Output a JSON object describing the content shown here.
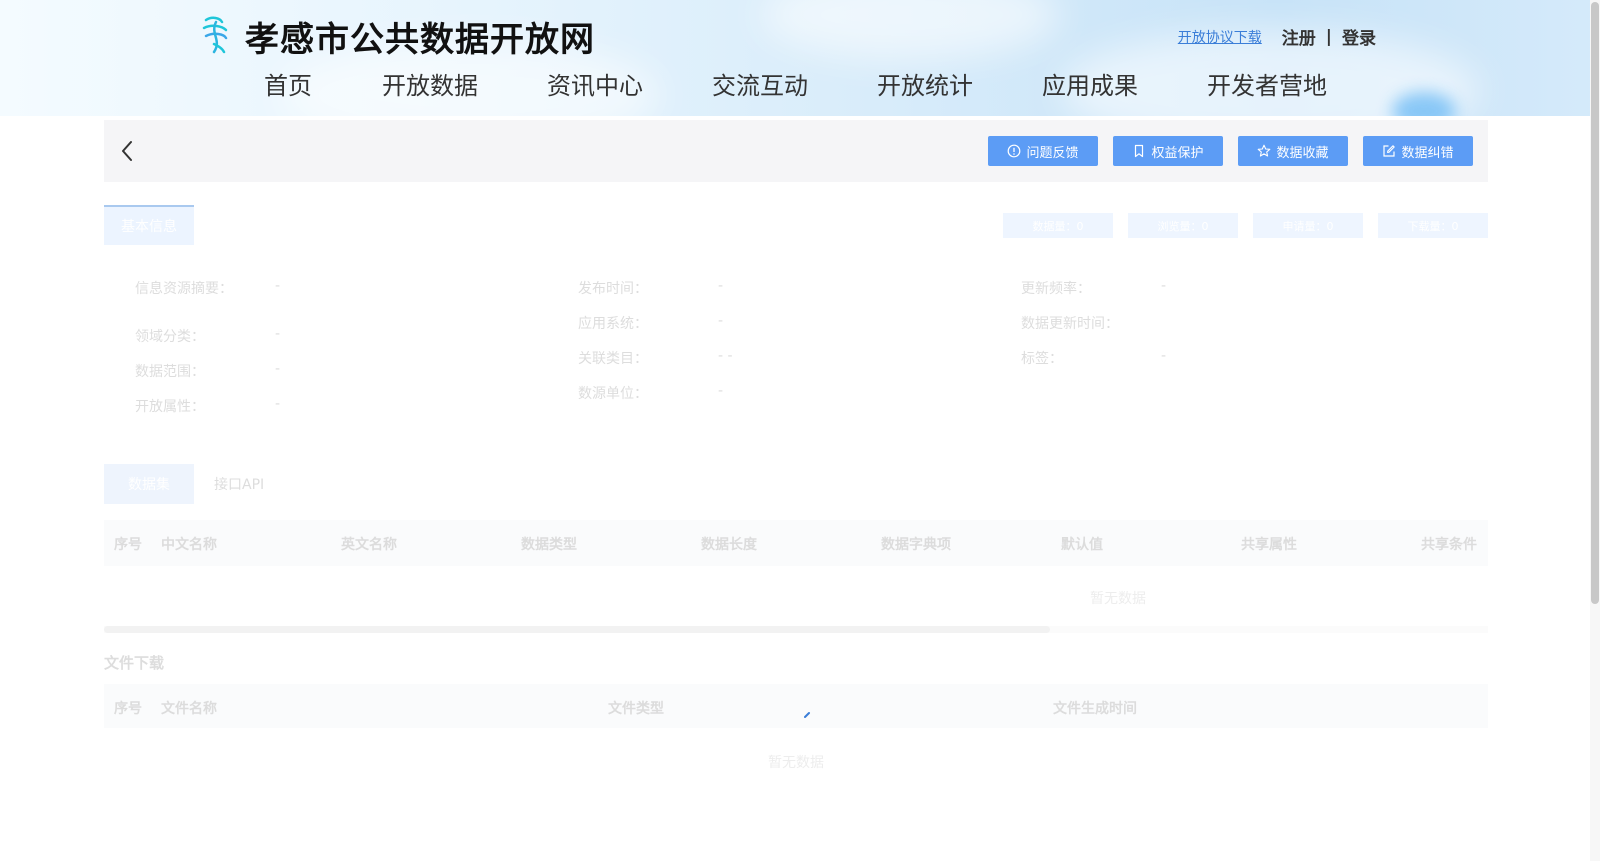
{
  "header": {
    "site_title": "孝感市公共数据开放网",
    "agreement_link": "开放协议下载",
    "register": "注册",
    "separator": "|",
    "login": "登录"
  },
  "nav": {
    "items": [
      "首页",
      "开放数据",
      "资讯中心",
      "交流互动",
      "开放统计",
      "应用成果",
      "开发者营地"
    ]
  },
  "toolbar": {
    "feedback": "问题反馈",
    "rights": "权益保护",
    "favorite": "数据收藏",
    "correction": "数据纠错"
  },
  "info": {
    "tab": "基本信息",
    "stats": [
      "数据量：0",
      "浏览量：0",
      "申请量：0",
      "下载量：0"
    ],
    "fields": [
      {
        "label": "信息资源摘要：",
        "value": "-"
      },
      {
        "label": "领域分类：",
        "value": "-"
      },
      {
        "label": "数据范围：",
        "value": "-"
      },
      {
        "label": "开放属性：",
        "value": "-"
      },
      {
        "label": "发布时间：",
        "value": "-"
      },
      {
        "label": "应用系统：",
        "value": "-"
      },
      {
        "label": "关联类目：",
        "value": "- -"
      },
      {
        "label": "数源单位：",
        "value": "-"
      },
      {
        "label": "更新频率：",
        "value": "-"
      },
      {
        "label": "数据更新时间：",
        "value": ""
      },
      {
        "label": "标签：",
        "value": "-"
      }
    ]
  },
  "dataset": {
    "tab_active": "数据集",
    "tab_api": "接口API",
    "columns": [
      "序号",
      "中文名称",
      "英文名称",
      "数据类型",
      "数据长度",
      "数据字典项",
      "默认值",
      "共享属性",
      "共享条件"
    ],
    "empty": "暂无数据"
  },
  "files": {
    "title": "文件下载",
    "columns": [
      "序号",
      "文件名称",
      "文件类型",
      "文件生成时间"
    ],
    "empty": "暂无数据"
  },
  "colors": {
    "primary_button": "#5c9cf5",
    "link": "#3b7ed8"
  }
}
